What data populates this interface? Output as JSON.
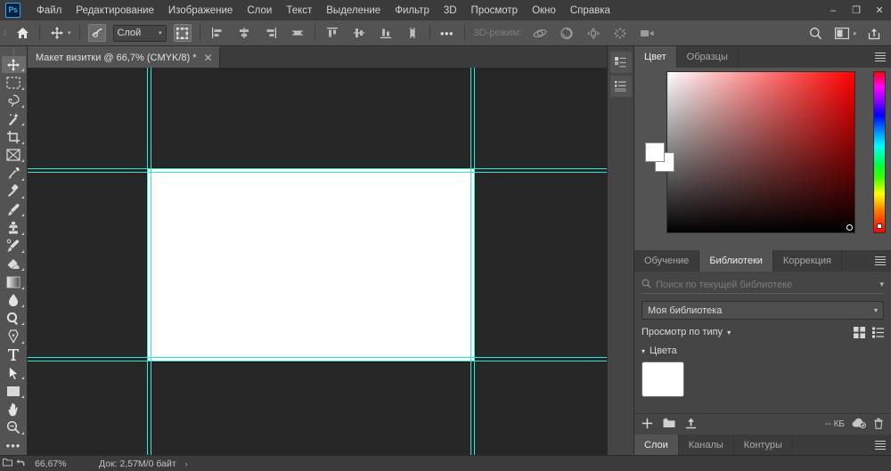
{
  "app": {
    "name": "Adobe Photoshop",
    "logo_text": "Ps"
  },
  "menubar": {
    "items": [
      {
        "label": "Файл",
        "name": "menu-file"
      },
      {
        "label": "Редактирование",
        "name": "menu-edit"
      },
      {
        "label": "Изображение",
        "name": "menu-image"
      },
      {
        "label": "Слои",
        "name": "menu-layers"
      },
      {
        "label": "Текст",
        "name": "menu-text"
      },
      {
        "label": "Выделение",
        "name": "menu-select"
      },
      {
        "label": "Фильтр",
        "name": "menu-filter"
      },
      {
        "label": "3D",
        "name": "menu-3d"
      },
      {
        "label": "Просмотр",
        "name": "menu-view"
      },
      {
        "label": "Окно",
        "name": "menu-window"
      },
      {
        "label": "Справка",
        "name": "menu-help"
      }
    ],
    "window_controls": {
      "minimize": "–",
      "maximize": "❐",
      "close": "✕"
    }
  },
  "options_bar": {
    "home_icon": "home-icon",
    "active_tool_icon": "move-tool-icon",
    "auto_select_label": "Слой",
    "transform_controls_icon": "transform-controls-icon",
    "align_icons": [
      "align-left-edges",
      "align-horizontal-centers",
      "align-right-edges",
      "distribute-horizontal"
    ],
    "align_icons_2": [
      "align-top-edges",
      "align-vertical-centers",
      "align-bottom-edges",
      "distribute-vertical"
    ],
    "more_label": "•••",
    "mode_3d_label": "3D-режим:",
    "mode_3d_icons": [
      "orbit-3d-icon",
      "roll-3d-icon",
      "pan-3d-icon",
      "slide-3d-icon",
      "camera-3d-icon"
    ],
    "right_icons": [
      "search-icon",
      "arrange-documents-icon",
      "share-icon"
    ]
  },
  "toolbar": {
    "tools": [
      {
        "name": "move-tool",
        "label": "Перемещение",
        "active": true
      },
      {
        "name": "rectangular-marquee-tool",
        "label": "Прямоугольная область"
      },
      {
        "name": "lasso-tool",
        "label": "Лассо"
      },
      {
        "name": "magic-wand-tool",
        "label": "Волшебная палочка"
      },
      {
        "name": "crop-tool",
        "label": "Рамка"
      },
      {
        "name": "frame-tool",
        "label": "Монтажная область"
      },
      {
        "name": "eyedropper-tool",
        "label": "Пипетка"
      },
      {
        "name": "healing-brush-tool",
        "label": "Восстанавливающая кисть"
      },
      {
        "name": "brush-tool",
        "label": "Кисть"
      },
      {
        "name": "clone-stamp-tool",
        "label": "Штамп"
      },
      {
        "name": "history-brush-tool",
        "label": "Архивная кисть"
      },
      {
        "name": "eraser-tool",
        "label": "Ластик"
      },
      {
        "name": "gradient-tool",
        "label": "Градиент"
      },
      {
        "name": "blur-tool",
        "label": "Размытие"
      },
      {
        "name": "dodge-tool",
        "label": "Осветлитель"
      },
      {
        "name": "pen-tool",
        "label": "Перо"
      },
      {
        "name": "type-tool",
        "label": "Текст"
      },
      {
        "name": "path-selection-tool",
        "label": "Выделение контура"
      },
      {
        "name": "rectangle-tool",
        "label": "Прямоугольник"
      },
      {
        "name": "hand-tool",
        "label": "Рука"
      },
      {
        "name": "zoom-tool",
        "label": "Масштаб"
      },
      {
        "name": "edit-toolbar",
        "label": "•••"
      }
    ]
  },
  "document": {
    "tab_title": "Макет визитки @ 66,7% (CMYK/8) *",
    "close_glyph": "✕",
    "canvas_background": "#262626",
    "artboard_color": "#ffffff",
    "guide_color": "#2ce8e0"
  },
  "dock_strip": {
    "buttons": [
      {
        "name": "history-panel-icon",
        "label": "История"
      },
      {
        "name": "actions-panel-icon",
        "label": "Операции"
      }
    ]
  },
  "color_panel": {
    "tabs": [
      {
        "label": "Цвет",
        "active": true,
        "name": "tab-color"
      },
      {
        "label": "Образцы",
        "active": false,
        "name": "tab-swatches"
      }
    ],
    "menu_icon": "panel-menu-icon",
    "foreground_color": "#ffffff",
    "background_color": "#ffffff",
    "field_hue": "#ff0000"
  },
  "libraries_panel": {
    "tabs": [
      {
        "label": "Обучение",
        "active": false,
        "name": "tab-learn"
      },
      {
        "label": "Библиотеки",
        "active": true,
        "name": "tab-libraries"
      },
      {
        "label": "Коррекция",
        "active": false,
        "name": "tab-adjustments"
      }
    ],
    "menu_icon": "panel-menu-icon",
    "search_placeholder": "Поиск по текущей библиотеке",
    "search_value": "",
    "search_icon": "search-icon",
    "search_caret": "chevron-down-icon",
    "library_select": "Моя библиотека",
    "view_label": "Просмотр по типу",
    "view_icons": [
      "grid-view-icon",
      "list-view-icon"
    ],
    "groups": [
      {
        "label": "Цвета",
        "name": "group-colors",
        "swatches": [
          "#ffffff"
        ]
      }
    ],
    "footer": {
      "left_icons": [
        "add-element-icon",
        "new-library-folder-icon",
        "upload-icon"
      ],
      "size_label": "-- КБ",
      "sync_icon": "cloud-sync-icon",
      "delete_icon": "trash-icon"
    }
  },
  "bottom_panel": {
    "tabs": [
      {
        "label": "Слои",
        "active": true,
        "name": "tab-layers"
      },
      {
        "label": "Каналы",
        "active": false,
        "name": "tab-channels"
      },
      {
        "label": "Контуры",
        "active": false,
        "name": "tab-paths"
      }
    ],
    "menu_icon": "panel-menu-icon"
  },
  "statusbar": {
    "zoom": "66,67%",
    "doc_info": "Док: 2,57M/0 байт",
    "arrow_glyph": "›"
  }
}
